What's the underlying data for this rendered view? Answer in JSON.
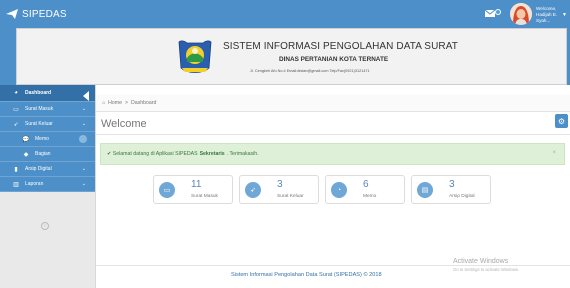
{
  "app": {
    "brand": "SIPEDAS",
    "brand_icon": "paper-plane-icon",
    "user_greeting": "Welcome,",
    "user_name": "Hadijah E. Syah..."
  },
  "banner": {
    "title": "SISTEM INFORMASI PENGOLAHAN DATA SURAT",
    "subtitle": "DINAS PERTANIAN KOTA TERNATE",
    "address": "Jl. Cengkeh Afo No.4 Email:distan@gmail.com Telp/Fax(0921)3121471"
  },
  "sidebar": {
    "items": [
      {
        "label": "Dashboard",
        "icon": "dashboard-icon"
      },
      {
        "label": "Surat Masuk",
        "icon": "inbox-icon"
      },
      {
        "label": "Surat Keluar",
        "icon": "send-icon"
      },
      {
        "label": "Memo",
        "icon": "comments-icon"
      },
      {
        "label": "Bagian",
        "icon": "tag-icon"
      },
      {
        "label": "Arsip Digital",
        "icon": "file-icon"
      },
      {
        "label": "Laporan",
        "icon": "bar-chart-icon"
      }
    ]
  },
  "breadcrumb": {
    "home": "Home",
    "separator": ">",
    "current": "Dashboard"
  },
  "page": {
    "title": "Welcome"
  },
  "alert": {
    "prefix": "Selamat datang di Aplikasi SIPEDAS",
    "role": "Sekretaris",
    "suffix": ". Terimakasih.",
    "close": "×"
  },
  "cards": [
    {
      "count": "11",
      "label": "Surat Masuk",
      "icon": "inbox-icon"
    },
    {
      "count": "3",
      "label": "Surat Keluar",
      "icon": "send-icon"
    },
    {
      "count": "6",
      "label": "Memo",
      "icon": "comments-icon"
    },
    {
      "count": "3",
      "label": "Arsip Digital",
      "icon": "hdd-icon"
    }
  ],
  "footer": {
    "text": "Sistem Informasi Pengolahan Data Surat (SIPEDAS) © 2018"
  },
  "watermark": {
    "title": "Activate Windows",
    "subtitle": "Go to Settings to activate Windows."
  },
  "colors": {
    "primary": "#4d8fc8",
    "sidebar_active": "#3470a8",
    "alert_bg": "#dff0d8",
    "alert_text": "#3c763d"
  }
}
